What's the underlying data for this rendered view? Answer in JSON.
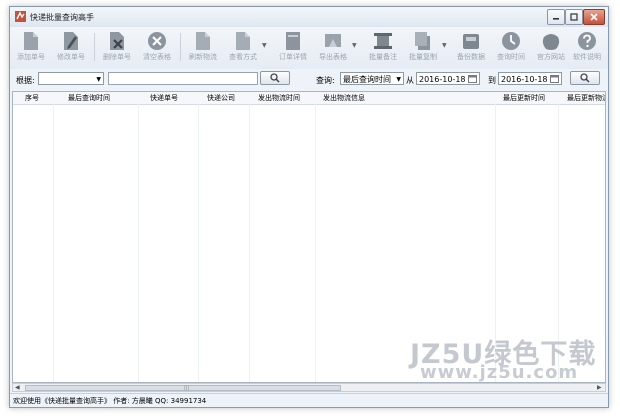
{
  "window": {
    "title": "快递批量查询高手",
    "colors": {
      "accent": "#c4513b",
      "toolbar_icon": "#8c959e",
      "disabled_text": "#9aa4ae"
    }
  },
  "toolbar": {
    "items": [
      {
        "label": "添加单号",
        "icon": "document-icon"
      },
      {
        "label": "修改单号",
        "icon": "edit-icon"
      },
      {
        "label": "删除单号",
        "icon": "delete-icon"
      },
      {
        "label": "清空表格",
        "icon": "clear-icon"
      },
      {
        "label": "刷新物流",
        "icon": "document-icon"
      },
      {
        "label": "查看方式",
        "icon": "view-icon"
      },
      {
        "label": "订单详情",
        "icon": "details-icon"
      },
      {
        "label": "导出表格",
        "icon": "export-icon"
      },
      {
        "label": "批量备注",
        "icon": "note-icon"
      },
      {
        "label": "批量复制",
        "icon": "copy-icon"
      },
      {
        "label": "备份数据",
        "icon": "backup-icon"
      },
      {
        "label": "查询时间",
        "icon": "clock-icon"
      },
      {
        "label": "官方网站",
        "icon": "website-icon"
      },
      {
        "label": "软件说明",
        "icon": "help-icon"
      }
    ]
  },
  "filter": {
    "label": "根据:",
    "field_value": "",
    "search_text": "",
    "query_label": "查询:",
    "query_type": "最后查询时间",
    "from_label": "从",
    "from_date": "2016-10-18",
    "to_label": "到",
    "to_date": "2016-10-18"
  },
  "table": {
    "columns": [
      "序号",
      "最后查询时间",
      "快递单号",
      "快递公司",
      "发出物流时间",
      "发出物流信息",
      "最后更新时间",
      "最后更新物流"
    ],
    "rows": []
  },
  "status": {
    "text": "欢迎使用《快递批量查询高手》 作者: 方晨曦 QQ: 34991734"
  },
  "watermark": {
    "line1": "JZ5U绿色下载",
    "line2": "www.jz5u.com"
  }
}
